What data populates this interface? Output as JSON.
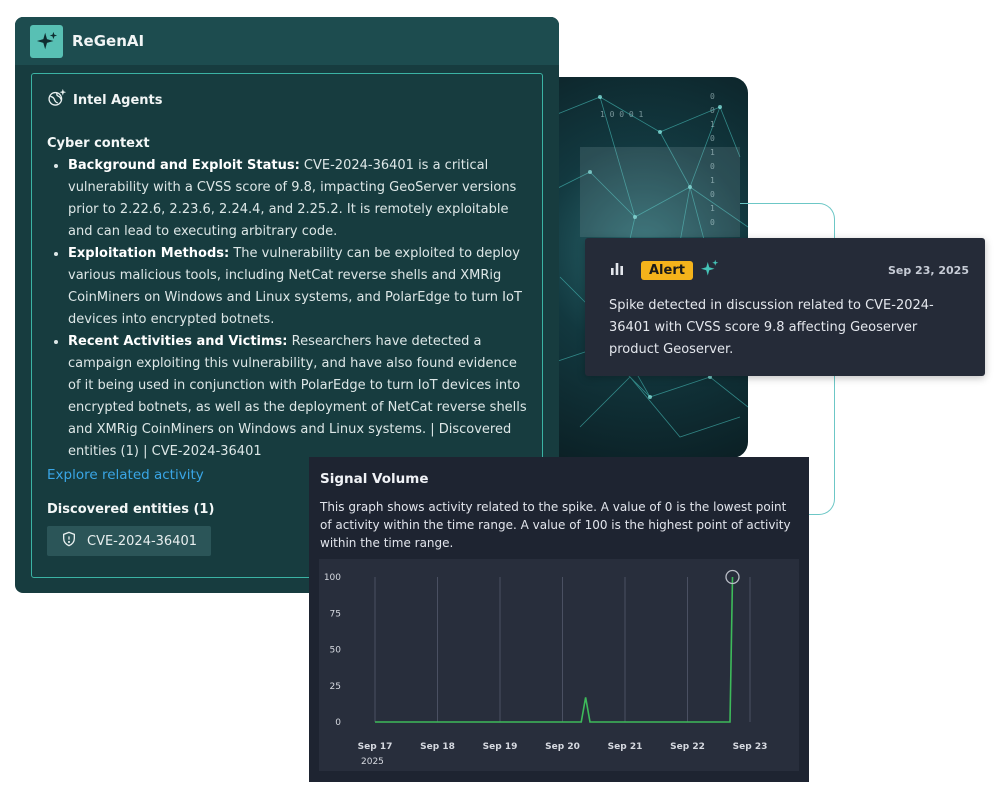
{
  "regen": {
    "title": "ReGenAI",
    "section_header": "Intel Agents",
    "context_title": "Cyber context",
    "bullets": [
      {
        "label": "Background and Exploit Status:",
        "text": " CVE-2024-36401 is a critical vulnerability with a CVSS score of 9.8, impacting GeoServer versions prior to 2.22.6, 2.23.6, 2.24.4, and 2.25.2. It is remotely exploitable and can lead to executing arbitrary code."
      },
      {
        "label": "Exploitation Methods:",
        "text": " The vulnerability can be exploited to deploy various malicious tools, including NetCat reverse shells and XMRig CoinMiners on Windows and Linux systems, and PolarEdge to turn IoT devices into encrypted botnets."
      },
      {
        "label": "Recent Activities and Victims:",
        "text": " Researchers have detected a campaign exploiting this vulnerability, and have also found evidence of it being used in conjunction with PolarEdge to turn IoT devices into encrypted botnets, as well as the deployment of NetCat reverse shells and XMRig CoinMiners on Windows and Linux systems. | Discovered entities (1) | CVE-2024-36401"
      }
    ],
    "explore_link": "Explore related activity",
    "entities_title": "Discovered entities (1)",
    "entity_chip": "CVE-2024-36401"
  },
  "alert": {
    "badge": "Alert",
    "date": "Sep 23, 2025",
    "text": "Spike detected in discussion related to CVE-2024-36401 with CVSS score 9.8 affecting Geoserver product Geoserver."
  },
  "signal": {
    "title": "Signal Volume",
    "description": "This graph shows activity related to the spike. A value of 0 is the lowest point of activity within the time range. A value of 100 is the highest point of activity within the time range."
  },
  "chart_data": {
    "type": "line",
    "title": "Signal Volume",
    "xlabel": "",
    "ylabel": "",
    "ylim": [
      0,
      100
    ],
    "y_ticks": [
      0,
      25,
      50,
      75,
      100
    ],
    "x_tick_labels": [
      "Sep 17",
      "Sep 18",
      "Sep 19",
      "Sep 20",
      "Sep 21",
      "Sep 22",
      "Sep 23"
    ],
    "x_year_label": "2025",
    "grid": "vertical",
    "series": [
      {
        "color": "#3dba5a",
        "x": [
          0,
          1,
          2,
          3,
          3.3,
          3.37,
          3.44,
          4,
          5,
          5.6,
          5.68,
          5.7,
          5.72
        ],
        "values": [
          0,
          0,
          0,
          0,
          0,
          17,
          0,
          0,
          0,
          0,
          0,
          50,
          100
        ]
      }
    ],
    "highlight": {
      "x": 5.72,
      "value": 100
    }
  },
  "colors": {
    "accent_teal": "#3bb3a4",
    "link_blue": "#3aa6e6",
    "alert_yellow": "#f5b31b",
    "line_green": "#3dba5a"
  }
}
